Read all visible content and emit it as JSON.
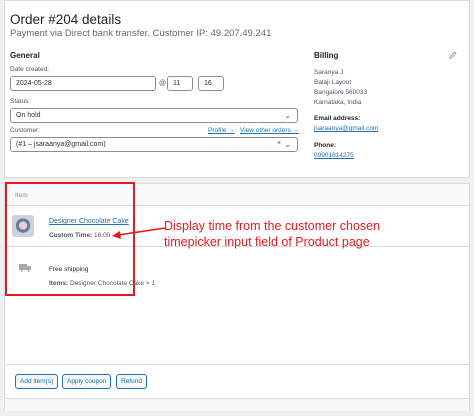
{
  "order": {
    "title": "Order #204 details",
    "meta": "Payment via Direct bank transfer. Customer IP: 49.207.49.241"
  },
  "general": {
    "heading": "General",
    "date_label": "Date created:",
    "date_value": "2024-05-28",
    "at": "@",
    "hour": "11",
    "minute": "16",
    "status_label": "Status:",
    "status_value": "On hold",
    "customer_label": "Customer:",
    "profile_link": "Profile →",
    "view_orders_link": "View other orders →",
    "customer_value": "(#1 – jsaraanya@gmail.com)"
  },
  "billing": {
    "heading": "Billing",
    "address": [
      "Saranya J",
      "Balaji Layout",
      "Bangalore 560033",
      "Karnataka, India"
    ],
    "email_label": "Email address:",
    "email": "jsaraanya@gmail.com",
    "phone_label": "Phone:",
    "phone": "09901814275"
  },
  "items": {
    "column_label": "Item",
    "product_name": "Designer Chocolate Cake",
    "custom_time_label": "Custom Time:",
    "custom_time_value": "16:00",
    "shipping_title": "Free shipping",
    "shipping_items_label": "Items:",
    "shipping_items_value": "Designer Chocolate Cake × 1"
  },
  "annotation": {
    "line1": "Display time from the customer chosen",
    "line2": "timepicker input field of Product page",
    "color": "#e41a1c"
  },
  "buttons": {
    "add_items": "Add item(s)",
    "apply_coupon": "Apply coupon",
    "refund": "Refund"
  },
  "colors": {
    "link": "#2271b1",
    "annotation": "#e41a1c"
  }
}
